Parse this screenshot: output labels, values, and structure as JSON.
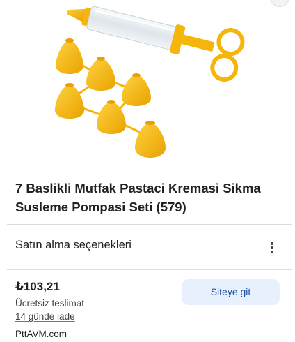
{
  "product": {
    "title": "7 Baslikli Mutfak Pastaci Kremasi Sikma Susleme Pompasi Seti (579)"
  },
  "purchase_options": {
    "label": "Satın alma seçenekleri"
  },
  "offer": {
    "price": "₺103,21",
    "shipping": "Ücretsiz teslimat",
    "returns": "14 günde iade",
    "merchant": "PttAVM.com",
    "visit_button": "Siteye git"
  },
  "colors": {
    "accent_button_bg": "#e8f0fe",
    "accent_button_text": "#174ea6",
    "product_yellow": "#f5b50a"
  }
}
